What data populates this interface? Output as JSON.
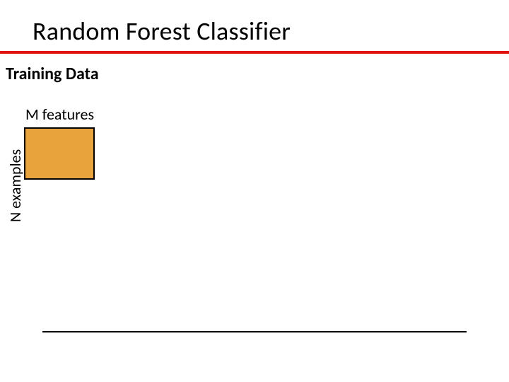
{
  "title": "Random Forest Classifier",
  "section_label": "Training Data",
  "col_label": "M features",
  "row_label": "N examples",
  "colors": {
    "underline": "#e11313",
    "box_fill": "#e8a33d",
    "box_border": "#000000"
  }
}
